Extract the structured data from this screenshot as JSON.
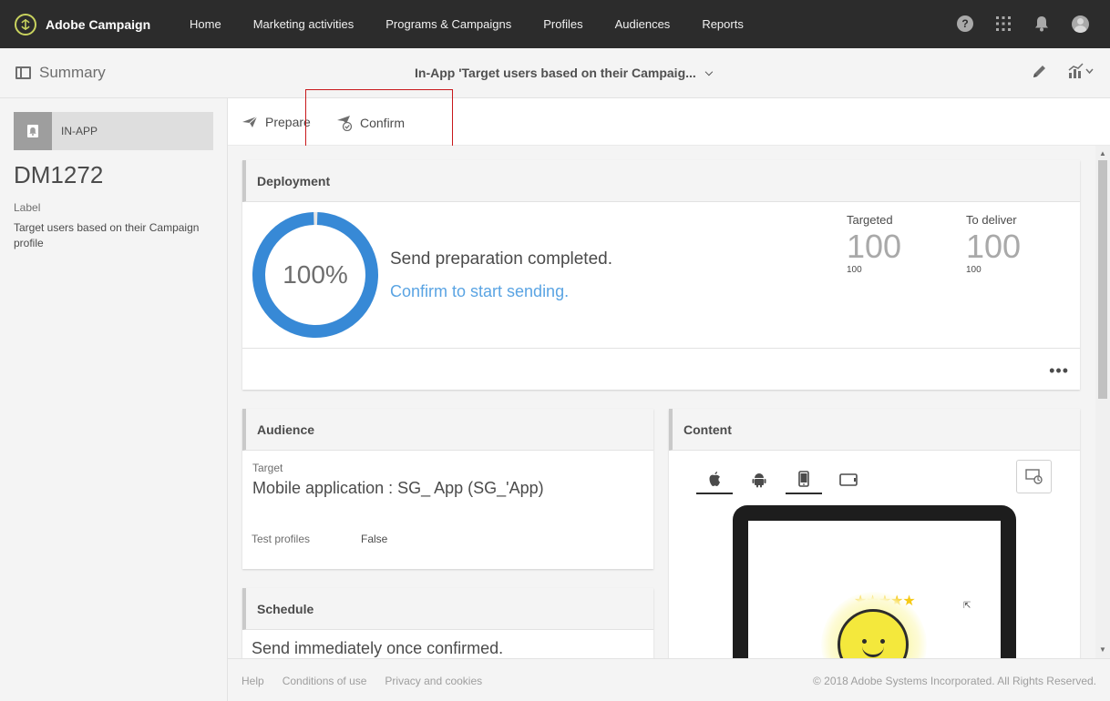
{
  "app": {
    "name": "Adobe Campaign",
    "logo_icon": "adobe-campaign-logo-icon"
  },
  "nav": {
    "items": [
      {
        "label": "Home"
      },
      {
        "label": "Marketing activities"
      },
      {
        "label": "Programs & Campaigns"
      },
      {
        "label": "Profiles"
      },
      {
        "label": "Audiences"
      },
      {
        "label": "Reports"
      }
    ],
    "icons": [
      "help-icon",
      "apps-grid-icon",
      "notifications-bell-icon",
      "user-avatar"
    ]
  },
  "header": {
    "summary_label": "Summary",
    "title": "In-App 'Target users based on their Campaig...",
    "actions": [
      "edit-pencil-icon",
      "reports-chart-icon"
    ]
  },
  "sidebar": {
    "channel": "IN-APP",
    "delivery_id": "DM1272",
    "label_caption": "Label",
    "label_value": "Target users based on their Campaign profile"
  },
  "actions": {
    "prepare": "Prepare",
    "confirm": "Confirm"
  },
  "deployment": {
    "title": "Deployment",
    "progress_percent_label": "100%",
    "progress_fraction": 1.0,
    "status": "Send preparation completed.",
    "link": "Confirm to start sending.",
    "targeted_label": "Targeted",
    "targeted_value": "100",
    "targeted_sub": "100",
    "to_deliver_label": "To deliver",
    "to_deliver_value": "100",
    "to_deliver_sub": "100"
  },
  "audience": {
    "title": "Audience",
    "target_label": "Target",
    "target_value": "Mobile application : SG_ App (SG_'App)",
    "test_profiles_label": "Test profiles",
    "test_profiles_value": "False"
  },
  "schedule": {
    "title": "Schedule",
    "text": "Send immediately once confirmed."
  },
  "content": {
    "title": "Content",
    "device_tabs": [
      "apple-icon",
      "android-icon",
      "phone-icon",
      "tablet-icon"
    ],
    "active_tab": "phone-icon",
    "stars": "★★★★★"
  },
  "footer": {
    "links": [
      "Help",
      "Conditions of use",
      "Privacy and cookies"
    ],
    "copyright": "© 2018 Adobe Systems Incorporated. All Rights Reserved."
  },
  "colors": {
    "topbar": "#2c2c2c",
    "accent_blue": "#5aa4e3",
    "donut": "#3789d6",
    "highlight": "#c8181b"
  }
}
